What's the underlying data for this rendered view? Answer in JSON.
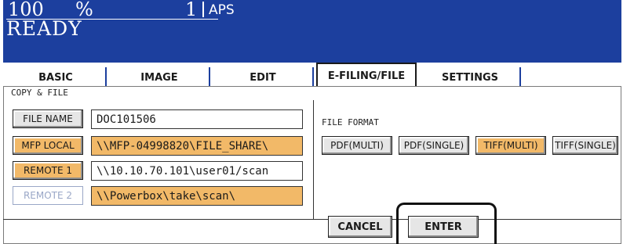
{
  "status": {
    "zoom_value": "100",
    "zoom_unit": "%",
    "copies": "1",
    "paper_mode": "APS",
    "state": "READY"
  },
  "tabs": [
    {
      "label": "BASIC",
      "active": false
    },
    {
      "label": "IMAGE",
      "active": false
    },
    {
      "label": "EDIT",
      "active": false
    },
    {
      "label": "E-FILING/FILE",
      "active": true
    },
    {
      "label": "SETTINGS",
      "active": false
    }
  ],
  "section": {
    "label": "COPY & FILE",
    "file_format_label": "FILE FORMAT"
  },
  "destinations": [
    {
      "button": "FILE NAME",
      "value": "DOC101506",
      "selected": false,
      "enabled": true
    },
    {
      "button": "MFP LOCAL",
      "value": "\\\\MFP-04998820\\FILE_SHARE\\",
      "selected": true,
      "enabled": true
    },
    {
      "button": "REMOTE 1",
      "value": "\\\\10.10.70.101\\user01/scan",
      "selected": true,
      "enabled": true
    },
    {
      "button": "REMOTE 2",
      "value": "\\\\Powerbox\\take\\scan\\",
      "selected": false,
      "enabled": false
    }
  ],
  "file_formats": [
    {
      "label": "PDF(MULTI)",
      "selected": false
    },
    {
      "label": "PDF(SINGLE)",
      "selected": false
    },
    {
      "label": "TIFF(MULTI)",
      "selected": true
    },
    {
      "label": "TIFF(SINGLE)",
      "selected": false
    }
  ],
  "footer": {
    "cancel_label": "CANCEL",
    "enter_label": "ENTER"
  },
  "colors": {
    "status_background": "#1c3f9e",
    "selected_highlight": "#f2b968",
    "disabled_text": "#9aa7c7"
  }
}
